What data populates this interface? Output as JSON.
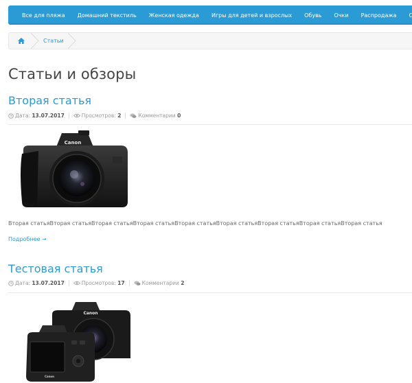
{
  "nav": {
    "items": [
      "Все для пляжа",
      "Домашний текстиль",
      "Женская одежда",
      "Игры для детей и взрослых",
      "Обувь",
      "Очки",
      "Распродажа",
      "Сумки и Рю"
    ]
  },
  "breadcrumb": {
    "home_icon": "home-icon",
    "current": "Статьи"
  },
  "page": {
    "title": "Статьи и обзоры"
  },
  "articles": [
    {
      "title": "Вторая статья",
      "date_label": "Дата:",
      "date": "13.07.2017",
      "views_label": "Просмотров:",
      "views": "2",
      "comments_label": "Комментарии",
      "comments": "0",
      "excerpt": "Вторая статьяВторая статьяВторая статьяВторая статьяВторая статьяВторая статьяВторая статьяВторая статьяВторая статья",
      "more": "Подробнее →"
    },
    {
      "title": "Тестовая статья",
      "date_label": "Дата:",
      "date": "13.07.2017",
      "views_label": "Просмотров:",
      "views": "17",
      "comments_label": "Комментарии",
      "comments": "2"
    }
  ],
  "brand_logo": "Canon",
  "colors": {
    "accent": "#2b9bd6",
    "meta_text": "#999999"
  }
}
